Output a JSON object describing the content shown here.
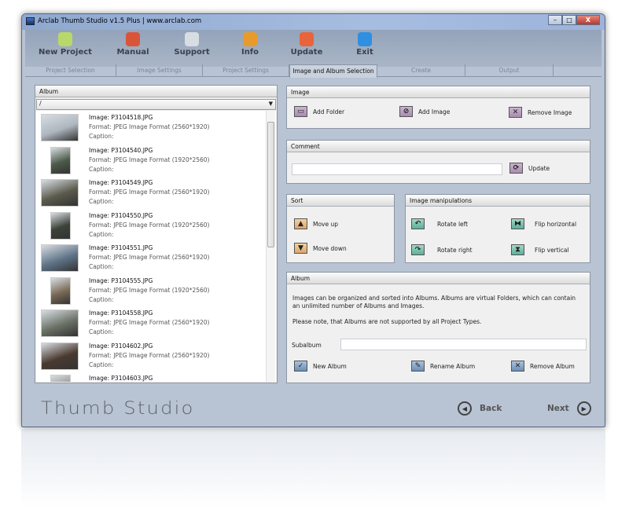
{
  "window": {
    "title": "Arclab Thumb Studio v1.5 Plus | www.arclab.com",
    "minimize": "–",
    "maximize": "□",
    "close": "X"
  },
  "toolbar": [
    {
      "label": "New Project",
      "icon": "new-project-icon",
      "color": "#b8d86a"
    },
    {
      "label": "Manual",
      "icon": "book-icon",
      "color": "#d9553a"
    },
    {
      "label": "Support",
      "icon": "compass-icon",
      "color": "#d8dde4"
    },
    {
      "label": "Info",
      "icon": "info-icon",
      "color": "#e89b2a"
    },
    {
      "label": "Update",
      "icon": "download-icon",
      "color": "#e8643a"
    },
    {
      "label": "Exit",
      "icon": "exit-arrow-icon",
      "color": "#2f8fe0"
    }
  ],
  "tabs": [
    "Project Selection",
    "Image Settings",
    "Project Settings",
    "Image and Album Selection",
    "Create",
    "Output"
  ],
  "album_panel": {
    "title": "Album",
    "combo_value": "/",
    "items": [
      {
        "name": "Image: P3104518.JPG",
        "format": "Format: JPEG Image Format (2560*1920)",
        "caption": "Caption:",
        "portrait": false,
        "color": "#aeb6bf"
      },
      {
        "name": "Image: P3104540.JPG",
        "format": "Format: JPEG Image Format (1920*2560)",
        "caption": "Caption:",
        "portrait": true,
        "color": "#4c5a4a"
      },
      {
        "name": "Image: P3104549.JPG",
        "format": "Format: JPEG Image Format (2560*1920)",
        "caption": "Caption:",
        "portrait": false,
        "color": "#5b5a4c"
      },
      {
        "name": "Image: P3104550.JPG",
        "format": "Format: JPEG Image Format (1920*2560)",
        "caption": "Caption:",
        "portrait": true,
        "color": "#3c4238"
      },
      {
        "name": "Image: P3104551.JPG",
        "format": "Format: JPEG Image Format (2560*1920)",
        "caption": "Caption:",
        "portrait": false,
        "color": "#5f7488"
      },
      {
        "name": "Image: P3104555.JPG",
        "format": "Format: JPEG Image Format (1920*2560)",
        "caption": "Caption:",
        "portrait": true,
        "color": "#7a6a55"
      },
      {
        "name": "Image: P3104558.JPG",
        "format": "Format: JPEG Image Format (2560*1920)",
        "caption": "Caption:",
        "portrait": false,
        "color": "#6b7266"
      },
      {
        "name": "Image: P3104602.JPG",
        "format": "Format: JPEG Image Format (2560*1920)",
        "caption": "Caption:",
        "portrait": false,
        "color": "#4a3a30"
      },
      {
        "name": "Image: P3104603.JPG",
        "format": "",
        "caption": "",
        "portrait": true,
        "color": "#8f8a80"
      }
    ]
  },
  "image_panel": {
    "title": "Image",
    "add_folder": "Add Folder",
    "add_image": "Add Image",
    "remove_image": "Remove Image"
  },
  "comment_panel": {
    "title": "Comment",
    "value": "",
    "update": "Update"
  },
  "sort_panel": {
    "title": "Sort",
    "move_up": "Move up",
    "move_down": "Move down"
  },
  "manip_panel": {
    "title": "Image manipulations",
    "rotate_left": "Rotate left",
    "rotate_right": "Rotate right",
    "flip_h": "Flip horizontal",
    "flip_v": "Flip vertical"
  },
  "album_box": {
    "title": "Album",
    "desc1": "Images can be organized and sorted into Albums. Albums are virtual Folders, which can contain an unlimited number of Albums and Images.",
    "desc2": "Please note, that Albums are not supported by all Project Types.",
    "subalbum_label": "Subalbum",
    "subalbum_value": "",
    "new": "New Album",
    "rename": "Rename Album",
    "remove": "Remove Album"
  },
  "footer": {
    "logo": "Thumb Studio",
    "back": "Back",
    "next": "Next"
  }
}
